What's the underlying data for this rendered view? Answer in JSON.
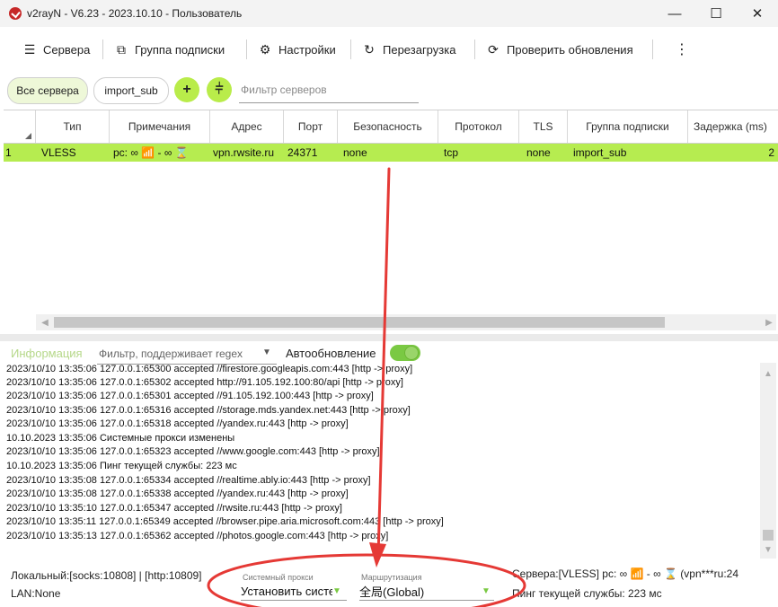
{
  "window": {
    "title": "v2rayN - V6.23 - 2023.10.10 - Пользователь",
    "minimize": "—",
    "maximize": "☐",
    "close": "✕"
  },
  "toolbar": {
    "servers": "Сервера",
    "subscription_group": "Группа подписки",
    "settings": "Настройки",
    "reload": "Перезагрузка",
    "check_updates": "Проверить обновления",
    "more": "⋮"
  },
  "filters": {
    "all_servers": "Все сервера",
    "import_sub": "import_sub",
    "add": "+",
    "split": "⫩",
    "server_filter_placeholder": "Фильтр серверов"
  },
  "grid": {
    "columns": [
      "Тип",
      "Примечания",
      "Адрес",
      "Порт",
      "Безопасность",
      "Протокол",
      "TLS",
      "Группа подписки",
      "Задержка (ms)"
    ],
    "rows": [
      {
        "index": "1",
        "type": "VLESS",
        "remarks": "pc: ∞ 📶 - ∞ ⌛",
        "address": "vpn.rwsite.ru",
        "port": "24371",
        "security": "none",
        "protocol": "tcp",
        "tls": "none",
        "group": "import_sub",
        "delay": "2"
      }
    ]
  },
  "info": {
    "label": "Информация",
    "log_filter_placeholder": "Фильтр, поддерживает regex",
    "autoupdate": "Автообновление",
    "autoupdate_on": true
  },
  "log": [
    "2023/10/10 13:35:06 127.0.0.1:65300 accepted //firestore.googleapis.com:443 [http -> proxy]",
    "2023/10/10 13:35:06 127.0.0.1:65302 accepted http://91.105.192.100:80/api [http -> proxy]",
    "2023/10/10 13:35:06 127.0.0.1:65301 accepted //91.105.192.100:443 [http -> proxy]",
    "2023/10/10 13:35:06 127.0.0.1:65316 accepted //storage.mds.yandex.net:443 [http -> proxy]",
    "2023/10/10 13:35:06 127.0.0.1:65318 accepted //yandex.ru:443 [http -> proxy]",
    "10.10.2023 13:35:06 Системные прокси изменены",
    "2023/10/10 13:35:06 127.0.0.1:65323 accepted //www.google.com:443 [http -> proxy]",
    "10.10.2023 13:35:06 Пинг текущей службы: 223 мс",
    "2023/10/10 13:35:08 127.0.0.1:65334 accepted //realtime.ably.io:443 [http -> proxy]",
    "2023/10/10 13:35:08 127.0.0.1:65338 accepted //yandex.ru:443 [http -> proxy]",
    "2023/10/10 13:35:10 127.0.0.1:65347 accepted //rwsite.ru:443 [http -> proxy]",
    "2023/10/10 13:35:11 127.0.0.1:65349 accepted //browser.pipe.aria.microsoft.com:443 [http -> proxy]",
    "2023/10/10 13:35:13 127.0.0.1:65362 accepted //photos.google.com:443 [http -> proxy]"
  ],
  "status": {
    "local": "Локальный:[socks:10808] | [http:10809]",
    "lan": "LAN:None",
    "system_proxy_label": "Системный прокси",
    "system_proxy_value": "Установить систе",
    "routing_label": "Маршрутизация",
    "routing_value": "全局(Global)",
    "servers": "Сервера:[VLESS] pc: ∞ 📶 - ∞ ⌛ (vpn***ru:24",
    "ping": "Пинг текущей службы: 223 мс"
  },
  "colors": {
    "accent": "#b6ec50",
    "annotation": "#e53935"
  }
}
